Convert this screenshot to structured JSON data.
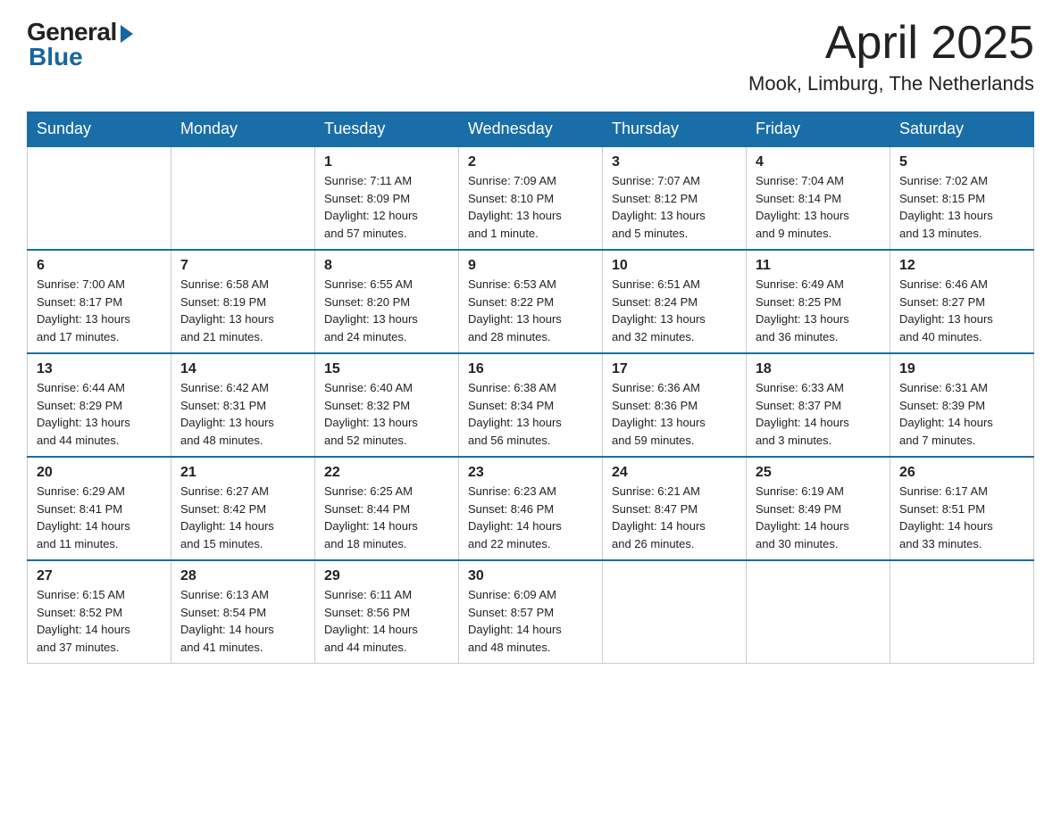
{
  "header": {
    "logo_general": "General",
    "logo_blue": "Blue",
    "month_title": "April 2025",
    "location": "Mook, Limburg, The Netherlands"
  },
  "weekdays": [
    "Sunday",
    "Monday",
    "Tuesday",
    "Wednesday",
    "Thursday",
    "Friday",
    "Saturday"
  ],
  "weeks": [
    [
      {
        "day": "",
        "info": ""
      },
      {
        "day": "",
        "info": ""
      },
      {
        "day": "1",
        "info": "Sunrise: 7:11 AM\nSunset: 8:09 PM\nDaylight: 12 hours\nand 57 minutes."
      },
      {
        "day": "2",
        "info": "Sunrise: 7:09 AM\nSunset: 8:10 PM\nDaylight: 13 hours\nand 1 minute."
      },
      {
        "day": "3",
        "info": "Sunrise: 7:07 AM\nSunset: 8:12 PM\nDaylight: 13 hours\nand 5 minutes."
      },
      {
        "day": "4",
        "info": "Sunrise: 7:04 AM\nSunset: 8:14 PM\nDaylight: 13 hours\nand 9 minutes."
      },
      {
        "day": "5",
        "info": "Sunrise: 7:02 AM\nSunset: 8:15 PM\nDaylight: 13 hours\nand 13 minutes."
      }
    ],
    [
      {
        "day": "6",
        "info": "Sunrise: 7:00 AM\nSunset: 8:17 PM\nDaylight: 13 hours\nand 17 minutes."
      },
      {
        "day": "7",
        "info": "Sunrise: 6:58 AM\nSunset: 8:19 PM\nDaylight: 13 hours\nand 21 minutes."
      },
      {
        "day": "8",
        "info": "Sunrise: 6:55 AM\nSunset: 8:20 PM\nDaylight: 13 hours\nand 24 minutes."
      },
      {
        "day": "9",
        "info": "Sunrise: 6:53 AM\nSunset: 8:22 PM\nDaylight: 13 hours\nand 28 minutes."
      },
      {
        "day": "10",
        "info": "Sunrise: 6:51 AM\nSunset: 8:24 PM\nDaylight: 13 hours\nand 32 minutes."
      },
      {
        "day": "11",
        "info": "Sunrise: 6:49 AM\nSunset: 8:25 PM\nDaylight: 13 hours\nand 36 minutes."
      },
      {
        "day": "12",
        "info": "Sunrise: 6:46 AM\nSunset: 8:27 PM\nDaylight: 13 hours\nand 40 minutes."
      }
    ],
    [
      {
        "day": "13",
        "info": "Sunrise: 6:44 AM\nSunset: 8:29 PM\nDaylight: 13 hours\nand 44 minutes."
      },
      {
        "day": "14",
        "info": "Sunrise: 6:42 AM\nSunset: 8:31 PM\nDaylight: 13 hours\nand 48 minutes."
      },
      {
        "day": "15",
        "info": "Sunrise: 6:40 AM\nSunset: 8:32 PM\nDaylight: 13 hours\nand 52 minutes."
      },
      {
        "day": "16",
        "info": "Sunrise: 6:38 AM\nSunset: 8:34 PM\nDaylight: 13 hours\nand 56 minutes."
      },
      {
        "day": "17",
        "info": "Sunrise: 6:36 AM\nSunset: 8:36 PM\nDaylight: 13 hours\nand 59 minutes."
      },
      {
        "day": "18",
        "info": "Sunrise: 6:33 AM\nSunset: 8:37 PM\nDaylight: 14 hours\nand 3 minutes."
      },
      {
        "day": "19",
        "info": "Sunrise: 6:31 AM\nSunset: 8:39 PM\nDaylight: 14 hours\nand 7 minutes."
      }
    ],
    [
      {
        "day": "20",
        "info": "Sunrise: 6:29 AM\nSunset: 8:41 PM\nDaylight: 14 hours\nand 11 minutes."
      },
      {
        "day": "21",
        "info": "Sunrise: 6:27 AM\nSunset: 8:42 PM\nDaylight: 14 hours\nand 15 minutes."
      },
      {
        "day": "22",
        "info": "Sunrise: 6:25 AM\nSunset: 8:44 PM\nDaylight: 14 hours\nand 18 minutes."
      },
      {
        "day": "23",
        "info": "Sunrise: 6:23 AM\nSunset: 8:46 PM\nDaylight: 14 hours\nand 22 minutes."
      },
      {
        "day": "24",
        "info": "Sunrise: 6:21 AM\nSunset: 8:47 PM\nDaylight: 14 hours\nand 26 minutes."
      },
      {
        "day": "25",
        "info": "Sunrise: 6:19 AM\nSunset: 8:49 PM\nDaylight: 14 hours\nand 30 minutes."
      },
      {
        "day": "26",
        "info": "Sunrise: 6:17 AM\nSunset: 8:51 PM\nDaylight: 14 hours\nand 33 minutes."
      }
    ],
    [
      {
        "day": "27",
        "info": "Sunrise: 6:15 AM\nSunset: 8:52 PM\nDaylight: 14 hours\nand 37 minutes."
      },
      {
        "day": "28",
        "info": "Sunrise: 6:13 AM\nSunset: 8:54 PM\nDaylight: 14 hours\nand 41 minutes."
      },
      {
        "day": "29",
        "info": "Sunrise: 6:11 AM\nSunset: 8:56 PM\nDaylight: 14 hours\nand 44 minutes."
      },
      {
        "day": "30",
        "info": "Sunrise: 6:09 AM\nSunset: 8:57 PM\nDaylight: 14 hours\nand 48 minutes."
      },
      {
        "day": "",
        "info": ""
      },
      {
        "day": "",
        "info": ""
      },
      {
        "day": "",
        "info": ""
      }
    ]
  ]
}
